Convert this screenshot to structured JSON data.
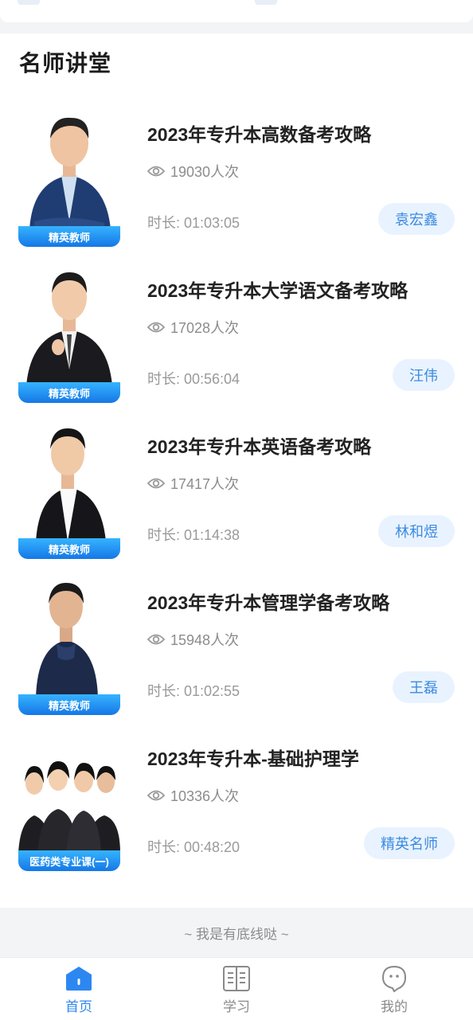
{
  "section": {
    "title": "名师讲堂"
  },
  "courses": [
    {
      "title": "2023年专升本高数备考攻略",
      "views": "19030人次",
      "duration": "时长: 01:03:05",
      "teacher": "袁宏鑫",
      "badge": "精英教师"
    },
    {
      "title": "2023年专升本大学语文备考攻略",
      "views": "17028人次",
      "duration": "时长: 00:56:04",
      "teacher": "汪伟",
      "badge": "精英教师"
    },
    {
      "title": "2023年专升本英语备考攻略",
      "views": "17417人次",
      "duration": "时长: 01:14:38",
      "teacher": "林和煜",
      "badge": "精英教师"
    },
    {
      "title": "2023年专升本管理学备考攻略",
      "views": "15948人次",
      "duration": "时长: 01:02:55",
      "teacher": "王磊",
      "badge": "精英教师"
    },
    {
      "title": "2023年专升本-基础护理学",
      "views": "10336人次",
      "duration": "时长: 00:48:20",
      "teacher": "精英名师",
      "badge": "医药类专业课(一)"
    }
  ],
  "footer": {
    "text": "~ 我是有底线哒 ~"
  },
  "tabbar": {
    "tabs": [
      {
        "label": "首页",
        "icon": "home-icon",
        "active": true
      },
      {
        "label": "学习",
        "icon": "book-icon",
        "active": false
      },
      {
        "label": "我的",
        "icon": "profile-icon",
        "active": false
      }
    ]
  },
  "colors": {
    "accent": "#2d87f0",
    "badge": "#1e88f0",
    "teacher_bg": "#e9f3ff"
  }
}
